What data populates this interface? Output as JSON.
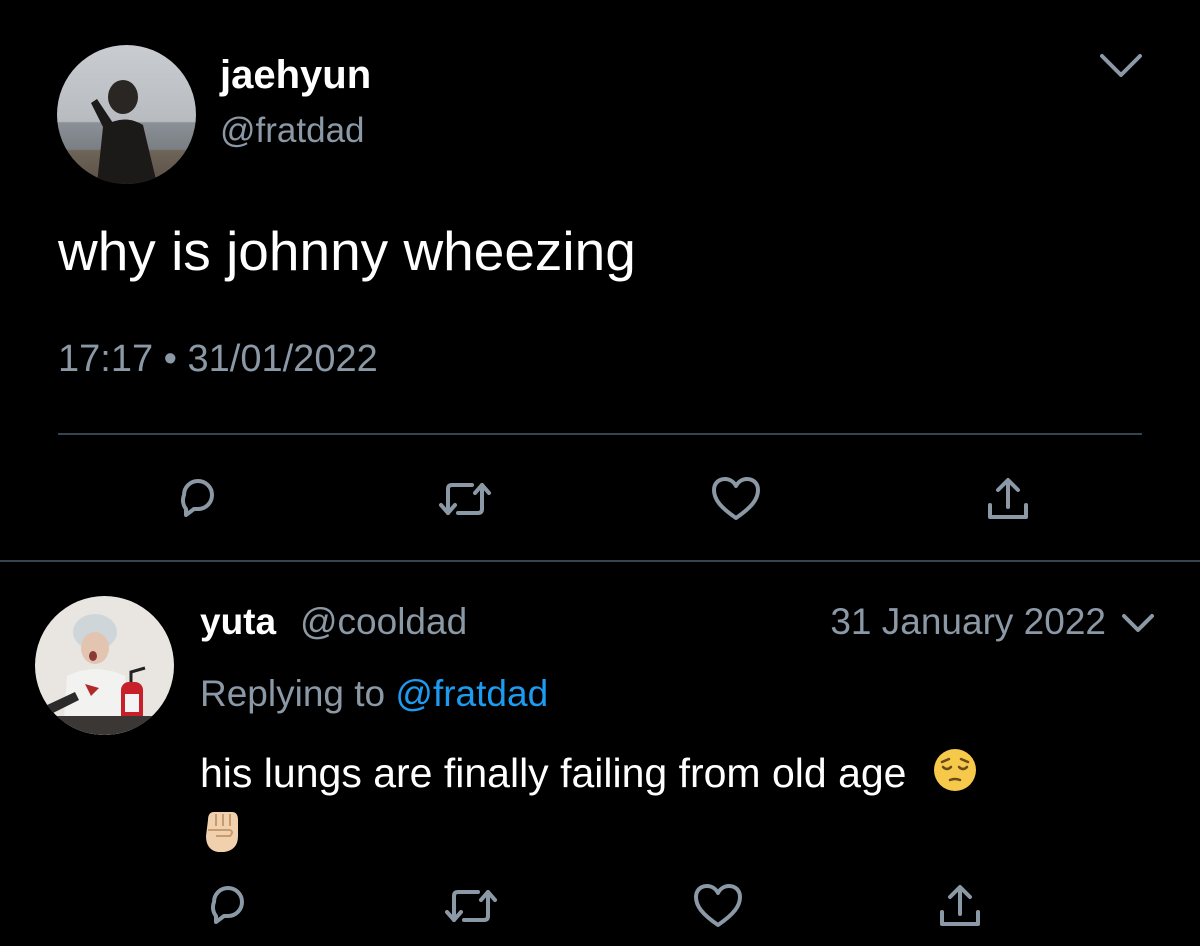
{
  "main_tweet": {
    "author_name": "jaehyun",
    "author_handle": "@fratdad",
    "text": "why is johnny wheezing",
    "time": "17:17",
    "separator": "•",
    "date": "31/01/2022",
    "actions": {
      "reply_icon": "reply-icon",
      "retweet_icon": "retweet-icon",
      "like_icon": "heart-icon",
      "share_icon": "share-icon"
    }
  },
  "reply_tweet": {
    "author_name": "yuta",
    "author_handle": "@cooldad",
    "date": "31 January 2022",
    "replying_prefix": "Replying to",
    "replying_handle": "@fratdad",
    "text": "his lungs are finally failing from old age",
    "emojis": [
      "pensive-face-emoji",
      "raised-fist-emoji"
    ]
  },
  "colors": {
    "background": "#000000",
    "text_primary": "#ffffff",
    "text_secondary": "#8b98a5",
    "accent": "#1d9bf0",
    "divider": "#38444d"
  }
}
